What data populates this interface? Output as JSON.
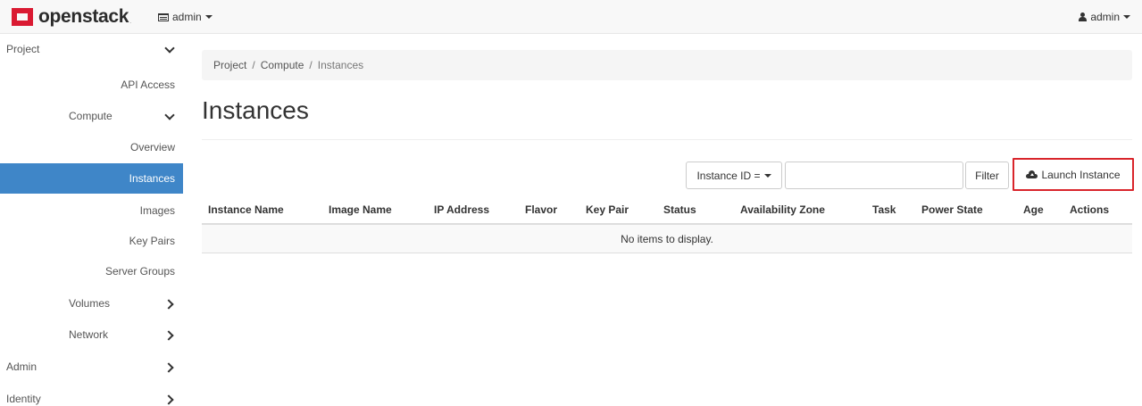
{
  "navbar": {
    "logo_text": "openstack",
    "logo_suffix": ".",
    "project_selector": "admin",
    "user_menu": "admin"
  },
  "sidebar": {
    "items": [
      {
        "label": "Project",
        "expanded": true
      },
      {
        "label": "API Access"
      },
      {
        "label": "Compute",
        "expanded": true
      },
      {
        "label": "Overview"
      },
      {
        "label": "Instances",
        "active": true
      },
      {
        "label": "Images"
      },
      {
        "label": "Key Pairs"
      },
      {
        "label": "Server Groups"
      },
      {
        "label": "Volumes"
      },
      {
        "label": "Network"
      },
      {
        "label": "Admin"
      },
      {
        "label": "Identity"
      }
    ]
  },
  "breadcrumb": {
    "items": [
      "Project",
      "Compute",
      "Instances"
    ],
    "separator": "/"
  },
  "page": {
    "title": "Instances"
  },
  "toolbar": {
    "filter_select": "Instance ID =",
    "filter_input_value": "",
    "filter_button": "Filter",
    "launch_button": "Launch Instance"
  },
  "table": {
    "columns": [
      "Instance Name",
      "Image Name",
      "IP Address",
      "Flavor",
      "Key Pair",
      "Status",
      "Availability Zone",
      "Task",
      "Power State",
      "Age",
      "Actions"
    ],
    "empty_message": "No items to display."
  },
  "colors": {
    "active_nav": "#3f86c8",
    "brand_red": "#da1a32",
    "highlight_border": "#d9252b"
  }
}
